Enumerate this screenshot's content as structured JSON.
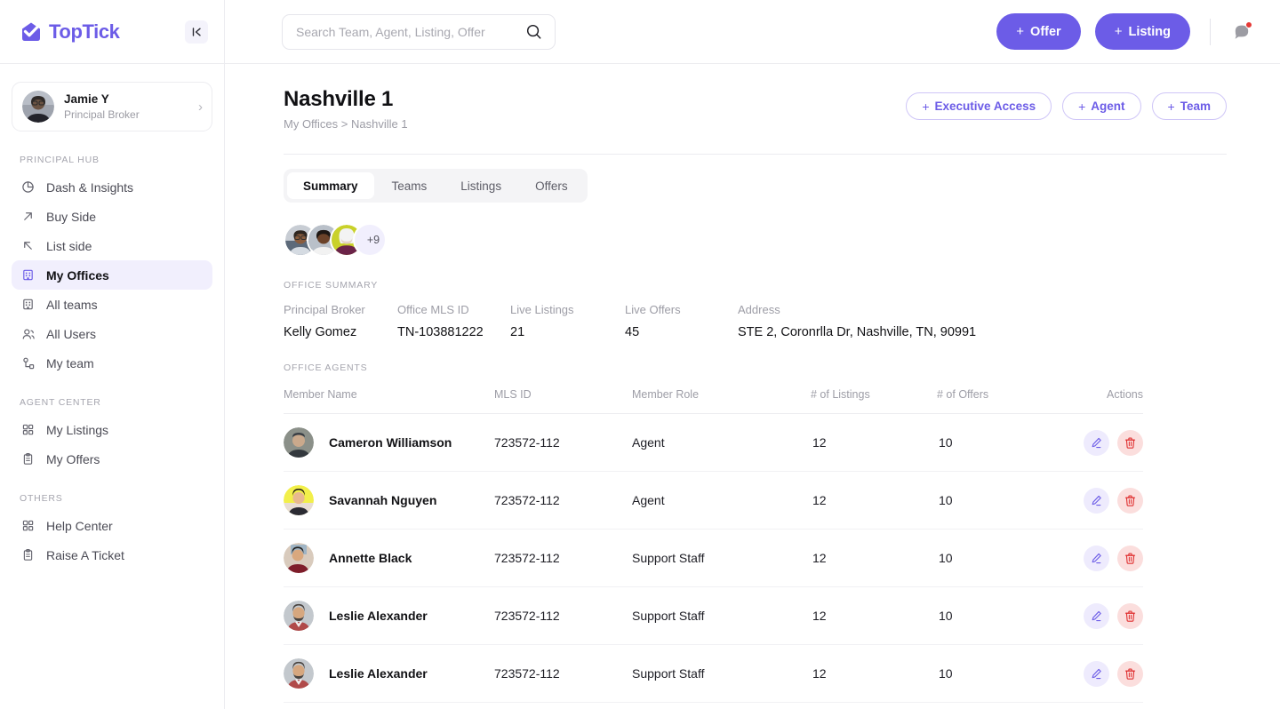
{
  "brand": {
    "name": "TopTick",
    "logo_icon": "check-envelope-icon",
    "accent": "#6c5ce7"
  },
  "sidebar": {
    "collapse_icon": "collapse-sidebar-icon",
    "profile": {
      "name": "Jamie Y",
      "role": "Principal Broker",
      "chevron_icon": "chevron-right-icon"
    },
    "groups": [
      {
        "label": "PRINCIPAL HUB",
        "items": [
          {
            "label": "Dash & Insights",
            "icon": "pie-chart-icon",
            "active": false
          },
          {
            "label": "Buy Side",
            "icon": "arrow-up-right-icon",
            "active": false
          },
          {
            "label": "List side",
            "icon": "arrow-up-left-icon",
            "active": false
          },
          {
            "label": "My Offices",
            "icon": "building-icon",
            "active": true
          },
          {
            "label": "All teams",
            "icon": "building-icon",
            "active": false
          },
          {
            "label": "All Users",
            "icon": "users-icon",
            "active": false
          },
          {
            "label": "My team",
            "icon": "org-chart-icon",
            "active": false
          }
        ]
      },
      {
        "label": "AGENT CENTER",
        "items": [
          {
            "label": "My Listings",
            "icon": "grid-icon",
            "active": false
          },
          {
            "label": "My Offers",
            "icon": "clipboard-icon",
            "active": false
          }
        ]
      },
      {
        "label": "OTHERS",
        "items": [
          {
            "label": "Help Center",
            "icon": "grid-icon",
            "active": false
          },
          {
            "label": "Raise A Ticket",
            "icon": "clipboard-icon",
            "active": false
          }
        ]
      }
    ]
  },
  "topbar": {
    "search": {
      "placeholder": "Search Team, Agent, Listing, Offer",
      "value": "",
      "icon": "search-icon"
    },
    "offer_button": {
      "label": "Offer",
      "plus": "+"
    },
    "listing_button": {
      "label": "Listing",
      "plus": "+"
    },
    "notification": {
      "icon": "chat-bubble-icon",
      "has_unread": true,
      "dot_color": "#e53935"
    }
  },
  "page": {
    "title": "Nashville 1",
    "breadcrumb": "My Offices > Nashville 1",
    "actions": [
      {
        "label": "Executive Access",
        "plus": "+"
      },
      {
        "label": "Agent",
        "plus": "+"
      },
      {
        "label": "Team",
        "plus": "+"
      }
    ],
    "tabs": [
      {
        "label": "Summary",
        "active": true
      },
      {
        "label": "Teams",
        "active": false
      },
      {
        "label": "Listings",
        "active": false
      },
      {
        "label": "Offers",
        "active": false
      }
    ],
    "avatar_stack": {
      "visible_count": 3,
      "overflow_label": "+9"
    },
    "office_summary": {
      "section_label": "OFFICE SUMMARY",
      "fields": [
        {
          "key": "Principal Broker",
          "value": "Kelly Gomez"
        },
        {
          "key": "Office MLS ID",
          "value": "TN-103881222"
        },
        {
          "key": "Live Listings",
          "value": "21"
        },
        {
          "key": "Live Offers",
          "value": "45"
        },
        {
          "key": "Address",
          "value": "STE 2, Coronrlla Dr, Nashville, TN, 90991"
        }
      ]
    },
    "office_agents": {
      "section_label": "OFFICE AGENTS",
      "columns": [
        "Member Name",
        "MLS ID",
        "Member Role",
        "# of Listings",
        "# of Offers",
        "Actions"
      ],
      "rows": [
        {
          "name": "Cameron Williamson",
          "mls_id": "723572-112",
          "role": "Agent",
          "listings": "12",
          "offers": "10",
          "edit_icon": "pencil-icon",
          "delete_icon": "trash-icon"
        },
        {
          "name": "Savannah Nguyen",
          "mls_id": "723572-112",
          "role": "Agent",
          "listings": "12",
          "offers": "10",
          "edit_icon": "pencil-icon",
          "delete_icon": "trash-icon"
        },
        {
          "name": "Annette Black",
          "mls_id": "723572-112",
          "role": "Support Staff",
          "listings": "12",
          "offers": "10",
          "edit_icon": "pencil-icon",
          "delete_icon": "trash-icon"
        },
        {
          "name": "Leslie Alexander",
          "mls_id": "723572-112",
          "role": "Support Staff",
          "listings": "12",
          "offers": "10",
          "edit_icon": "pencil-icon",
          "delete_icon": "trash-icon"
        },
        {
          "name": "Leslie Alexander",
          "mls_id": "723572-112",
          "role": "Support Staff",
          "listings": "12",
          "offers": "10",
          "edit_icon": "pencil-icon",
          "delete_icon": "trash-icon"
        }
      ]
    }
  }
}
